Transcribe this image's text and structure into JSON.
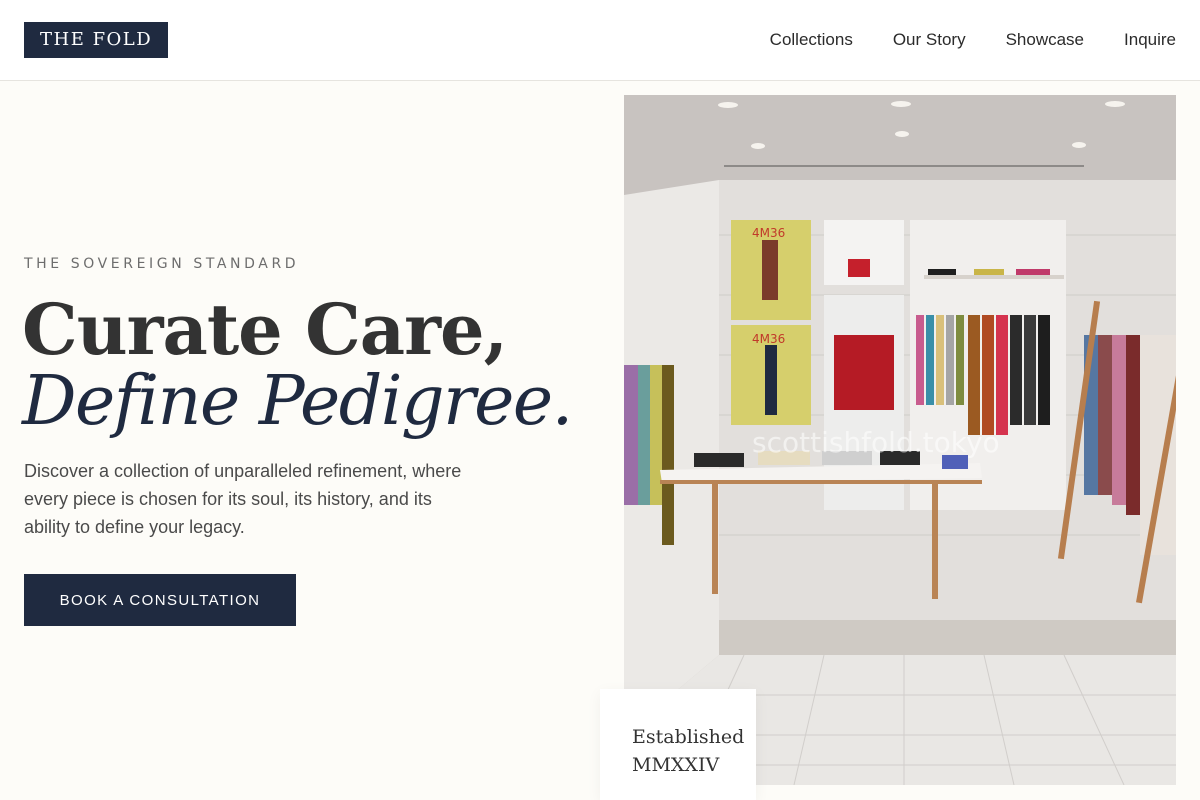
{
  "header": {
    "logo": "THE FOLD",
    "nav": [
      "Collections",
      "Our Story",
      "Showcase",
      "Inquire"
    ]
  },
  "hero": {
    "eyebrow": "THE SOVEREIGN STANDARD",
    "headline_line1": "Curate Care,",
    "headline_line2": "Define Pedigree.",
    "body": "Discover a collection of unparalleled refinement, where every piece is chosen for its soul, its history, and its ability to define your legacy.",
    "cta_label": "BOOK A CONSULTATION"
  },
  "image": {
    "poster_label": "4M36",
    "watermark": "scottishfold.tokyo"
  },
  "established": {
    "line1": "Established",
    "line2": "MMXXIV"
  },
  "colors": {
    "navy": "#1f2a40",
    "background": "#fdfcf8"
  }
}
